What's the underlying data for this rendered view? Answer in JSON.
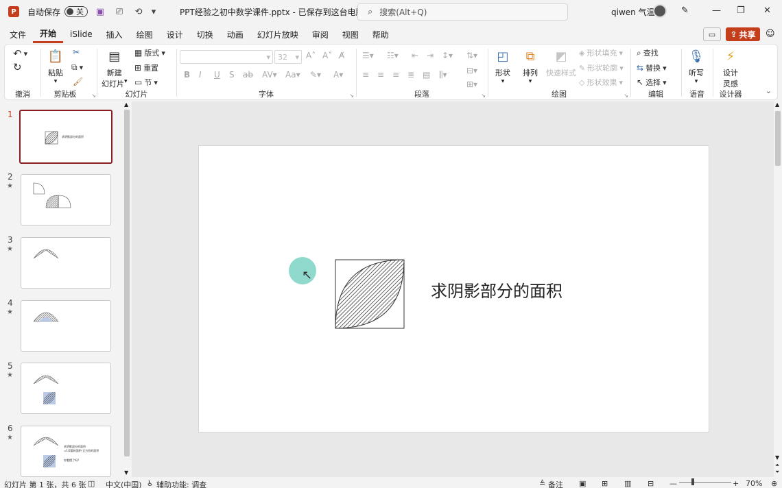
{
  "titlebar": {
    "logo": "P",
    "autosave_label": "自动保存",
    "autosave_state": "关",
    "doc_title": "PPT经验之初中数学课件.pptx - 已保存到这台电脑",
    "search_placeholder": "搜索(Alt+Q)",
    "user_name": "qiwen 气温"
  },
  "menu": {
    "items": [
      "文件",
      "开始",
      "iSlide",
      "插入",
      "绘图",
      "设计",
      "切换",
      "动画",
      "幻灯片放映",
      "审阅",
      "视图",
      "帮助"
    ],
    "active": "开始",
    "share_label": "共享"
  },
  "ribbon": {
    "undo_group": "撤消",
    "clipboard": {
      "label": "剪贴板",
      "paste": "粘贴"
    },
    "slides": {
      "label": "幻灯片",
      "new_slide": "新建",
      "new_slide2": "幻灯片",
      "layout": "版式",
      "reset": "重置",
      "section": "节"
    },
    "font": {
      "label": "字体",
      "size": "32"
    },
    "paragraph": {
      "label": "段落"
    },
    "drawing": {
      "label": "绘图",
      "shapes": "形状",
      "arrange": "排列",
      "quick_styles": "快速样式",
      "fill": "形状填充",
      "outline": "形状轮廓",
      "effects": "形状效果"
    },
    "editing": {
      "label": "编辑",
      "find": "查找",
      "replace": "替换",
      "select": "选择"
    },
    "voice": {
      "label": "语音",
      "dictate": "听写"
    },
    "designer": {
      "label": "设计器",
      "design_ideas": "设计",
      "design_ideas2": "灵感"
    }
  },
  "slides": [
    {
      "number": "1",
      "starred": false,
      "text": "求阴影部分的面积"
    },
    {
      "number": "2",
      "starred": true
    },
    {
      "number": "3",
      "starred": true
    },
    {
      "number": "4",
      "starred": true
    },
    {
      "number": "5",
      "starred": true
    },
    {
      "number": "6",
      "starred": true,
      "text_lines": [
        "求阴影部分的面积",
        "=1/2圆的面积-正方形的面积",
        "你看懂了吗?"
      ]
    }
  ],
  "current_slide": {
    "title": "求阴影部分的面积"
  },
  "status": {
    "slide_info": "幻灯片 第 1 张，共 6 张",
    "language": "中文(中国)",
    "accessibility": "辅助功能: 调查",
    "notes": "备注",
    "zoom": "70%"
  },
  "colors": {
    "accent": "#c43e1c",
    "selected_thumb": "#8a1f1f",
    "cursor_highlight": "#7cd3c4"
  }
}
